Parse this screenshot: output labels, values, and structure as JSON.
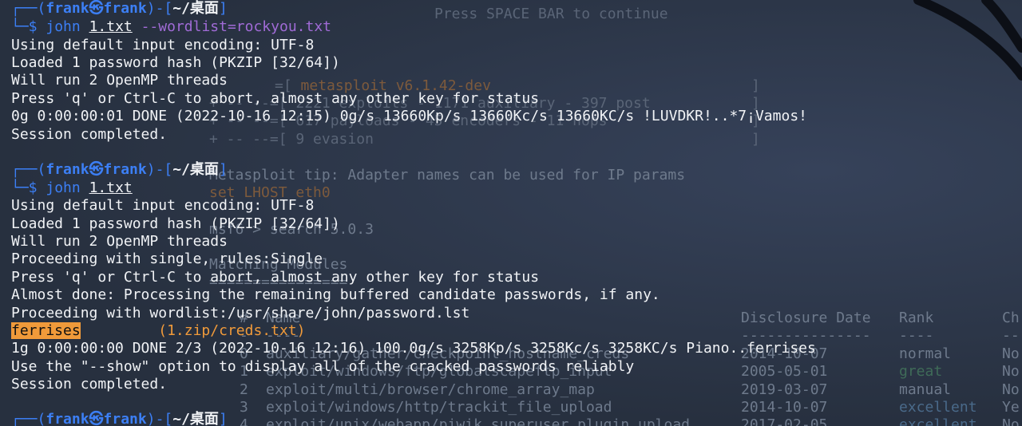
{
  "background": {
    "top_message": "Press SPACE BAR to continue",
    "banner": [
      {
        "prefix": "=[ ",
        "text": "metasploit v6.1.42-dev",
        "suffix": "]"
      },
      {
        "prefix": "+ -- --=[ ",
        "text": "2221 exploits - 1171 auxiliary - 397 post",
        "suffix": "]"
      },
      {
        "prefix": "+ -- --=[ ",
        "text": "617 payloads - 45 encoders - 11 nops",
        "suffix": "]"
      },
      {
        "prefix": "+ -- --=[ ",
        "text": "9 evasion",
        "suffix": "]"
      }
    ],
    "tip": "Metasploit tip: Adapter names can be used for IP params",
    "tip_cmd": "set LHOST eth0",
    "search_cmd": "msf6 > search 5.0.3",
    "matching": "Matching Modules",
    "matching_underline": "================",
    "table": {
      "headers": {
        "num": "#",
        "name": "Name",
        "date": "Disclosure Date",
        "rank": "Rank",
        "check": "Ch"
      },
      "underline": {
        "num": "-",
        "name": "----",
        "date": "---------------",
        "rank": "----",
        "check": "--"
      },
      "rows": [
        {
          "num": "0",
          "name": "auxiliary/gather/checkpoint_hostname_creds",
          "date": "2014-10-07",
          "rank": "normal",
          "check": "No"
        },
        {
          "num": "1",
          "name": "exploit/windows/ftp/globalscapeftp_input",
          "date": "2005-05-01",
          "rank": "great",
          "check": "No"
        },
        {
          "num": "2",
          "name": "exploit/multi/browser/chrome_array_map",
          "date": "2019-03-07",
          "rank": "manual",
          "check": "No"
        },
        {
          "num": "3",
          "name": "exploit/windows/http/trackit_file_upload",
          "date": "2014-10-07",
          "rank": "excellent",
          "check": "Ye"
        },
        {
          "num": "4",
          "name": "exploit/unix/webapp/piwik_superuser_plugin_upload",
          "date": "2017-02-05",
          "rank": "excellent",
          "check": "No"
        }
      ]
    }
  },
  "terminal": {
    "prompt": {
      "open": "┌──(",
      "user": "frank㉿frank",
      "mid": ")-[",
      "path": "~/桌面",
      "close": "]",
      "second": "└─$ "
    },
    "session1": {
      "cmd": "john",
      "file": "1.txt",
      "opt": "--wordlist=rockyou.txt",
      "lines": [
        "Using default input encoding: UTF-8",
        "Loaded 1 password hash (PKZIP [32/64])",
        "Will run 2 OpenMP threads",
        "Press 'q' or Ctrl-C to abort, almost any other key for status",
        "0g 0:00:00:01 DONE (2022-10-16 12:15) 0g/s 13660Kp/s 13660Kc/s 13660KC/s !LUVDKR!..*7¡Vamos!",
        "Session completed."
      ]
    },
    "session2": {
      "cmd": "john",
      "file": "1.txt",
      "lines_before": [
        "Using default input encoding: UTF-8",
        "Loaded 1 password hash (PKZIP [32/64])",
        "Will run 2 OpenMP threads",
        "Proceeding with single, rules:Single",
        "Press 'q' or Ctrl-C to abort, almost any other key for status",
        "Almost done: Processing the remaining buffered candidate passwords, if any.",
        "Proceeding with wordlist:/usr/share/john/password.lst"
      ],
      "found_password": "ferrises",
      "found_spacer": "         ",
      "found_source": "(1.zip/creds.txt)",
      "lines_after": [
        "1g 0:00:00:00 DONE 2/3 (2022-10-16 12:16) 100.0g/s 3258Kp/s 3258Kc/s 3258KC/s Piano..ferrises",
        "Use the \"--show\" option to display all of the cracked passwords reliably",
        "Session completed."
      ]
    }
  }
}
